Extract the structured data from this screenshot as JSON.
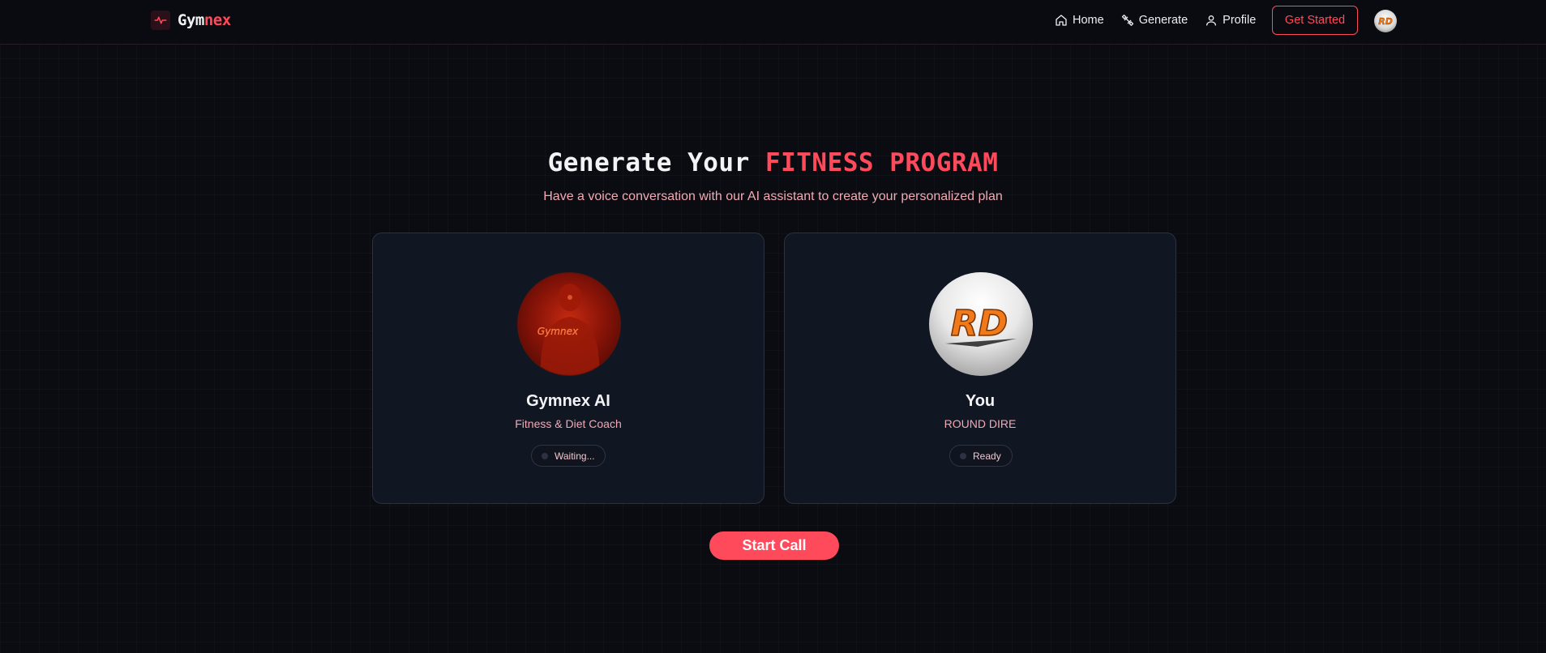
{
  "header": {
    "brand": {
      "part1": "Gym",
      "part2": "nex",
      "icon": "activity-pulse-icon"
    },
    "nav": [
      {
        "label": "Home",
        "icon": "home-icon"
      },
      {
        "label": "Generate",
        "icon": "dumbbell-icon"
      },
      {
        "label": "Profile",
        "icon": "user-icon"
      }
    ],
    "cta_label": "Get Started",
    "avatar_initials": "RD"
  },
  "hero": {
    "title_part1": "Generate Your",
    "title_part2": "FITNESS PROGRAM",
    "subtitle": "Have a voice conversation with our AI assistant to create your personalized plan"
  },
  "cards": {
    "ai": {
      "name": "Gymnex AI",
      "role": "Fitness & Diet Coach",
      "status": "Waiting...",
      "avatar_text": "Gymnex"
    },
    "me": {
      "name": "You",
      "role": "ROUND DIRE",
      "status": "Ready",
      "avatar_text": "RD"
    }
  },
  "start_call_label": "Start Call",
  "colors": {
    "accent": "#ff4a5c",
    "subtitle": "#f4a9b2",
    "background": "#0a0c12",
    "card": "#111623"
  }
}
